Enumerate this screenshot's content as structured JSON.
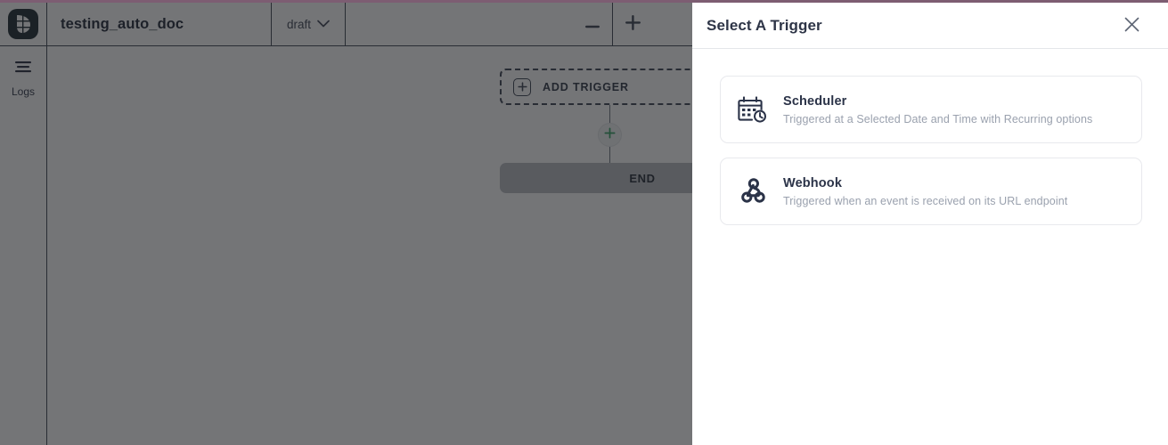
{
  "theme": {
    "top_strip_color": "#7d5d72",
    "accent_green": "#2f9e5f",
    "panel_bg": "#ffffff",
    "scrim_color": "rgba(30,32,36,0.62)",
    "title_color": "#2e3547",
    "muted_text": "#9aa1ae",
    "card_border": "#e8e9ed",
    "end_node_bg": "#b9bcc1"
  },
  "topbar": {
    "logo_icon": "app-leaf-logo-icon",
    "document_title": "testing_auto_doc",
    "status": {
      "label": "draft",
      "chevron_icon": "chevron-down-icon"
    },
    "zoom_out": {
      "label": "−",
      "icon": "minus-icon"
    },
    "zoom_in": {
      "label": "+",
      "icon": "plus-icon"
    }
  },
  "sidebar": {
    "items": [
      {
        "label": "Logs",
        "icon": "logs-lines-icon"
      }
    ]
  },
  "canvas": {
    "trigger_node": {
      "label": "ADD TRIGGER",
      "icon": "plus-square-icon"
    },
    "add_step_button": {
      "icon": "plus-icon",
      "label": "+"
    },
    "end_node": {
      "label": "END"
    }
  },
  "panel": {
    "title": "Select A Trigger",
    "close_icon": "close-icon",
    "triggers": [
      {
        "title": "Scheduler",
        "description": "Triggered at a Selected Date and Time with Recurring options",
        "icon": "calendar-clock-icon"
      },
      {
        "title": "Webhook",
        "description": "Triggered when an event is received on its URL endpoint",
        "icon": "webhook-icon"
      }
    ]
  }
}
